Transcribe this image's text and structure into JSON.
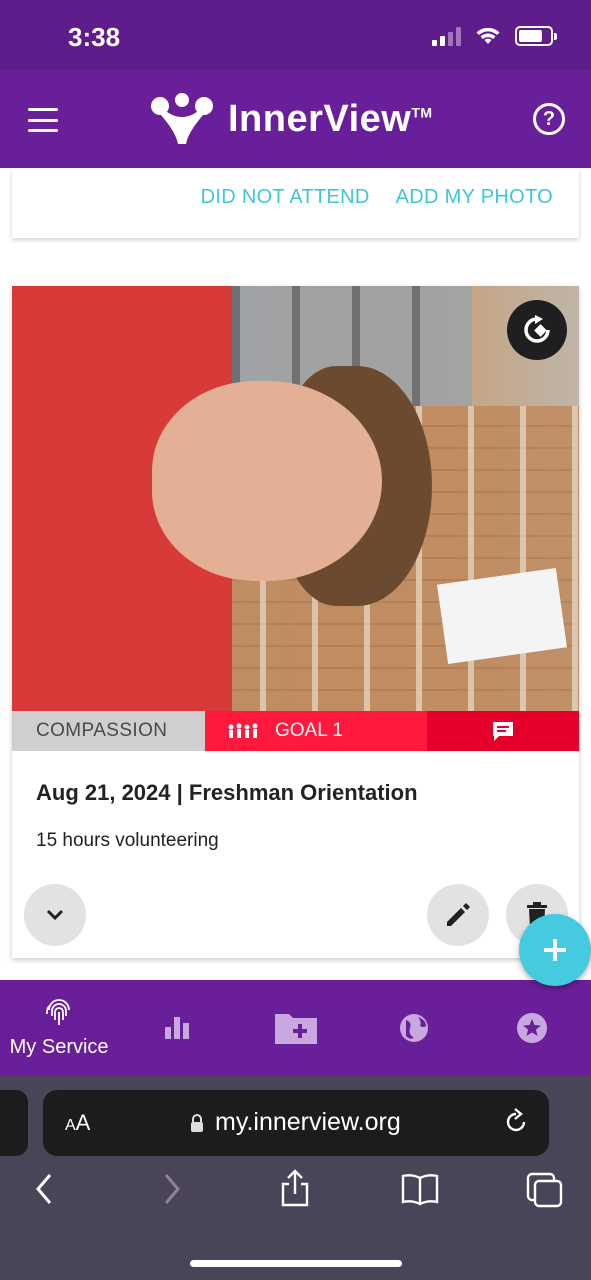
{
  "status_bar": {
    "time": "3:38",
    "icons": [
      "cellular-signal-icon",
      "wifi-icon",
      "battery-icon"
    ]
  },
  "header": {
    "logo_text": "InnerView",
    "logo_tm": "TM",
    "menu_icon": "hamburger-menu-icon",
    "help_icon": "help-circle-icon",
    "help_glyph": "?"
  },
  "previous_card": {
    "did_not_attend_label": "DID NOT ATTEND",
    "add_photo_label": "ADD MY PHOTO"
  },
  "entry_card": {
    "rotate_icon": "rotate-image-icon",
    "category": "COMPASSION",
    "goal_label": "GOAL 1",
    "goal_icon": "people-group-icon",
    "comment_icon": "comment-icon",
    "date": "Aug 21, 2024",
    "separator": "|",
    "event": "Freshman Orientation",
    "description": "15 hours volunteering",
    "expand_icon": "chevron-down-icon",
    "edit_icon": "pencil-icon",
    "delete_icon": "trash-icon"
  },
  "fab": {
    "icon": "plus-icon",
    "glyph": "+"
  },
  "bottom_nav": [
    {
      "label": "My Service",
      "icon": "fingerprint-icon",
      "active": true
    },
    {
      "label": "",
      "icon": "bar-chart-icon"
    },
    {
      "label": "",
      "icon": "add-folder-icon"
    },
    {
      "label": "",
      "icon": "globe-icon"
    },
    {
      "label": "",
      "icon": "star-badge-icon"
    }
  ],
  "browser": {
    "text_size_label_small": "A",
    "text_size_label_large": "A",
    "url": "my.innerview.org",
    "icons": [
      "lock-icon",
      "reload-icon",
      "back-icon",
      "forward-icon",
      "share-icon",
      "bookmarks-icon",
      "tabs-icon"
    ]
  },
  "colors": {
    "header_purple": "#6a1f9a",
    "status_purple": "#5f1d8c",
    "accent_cyan": "#3ec6d9",
    "goal_red": "#ff1a3d",
    "comment_red": "#e4002b",
    "category_gray": "#cfcfcf"
  }
}
